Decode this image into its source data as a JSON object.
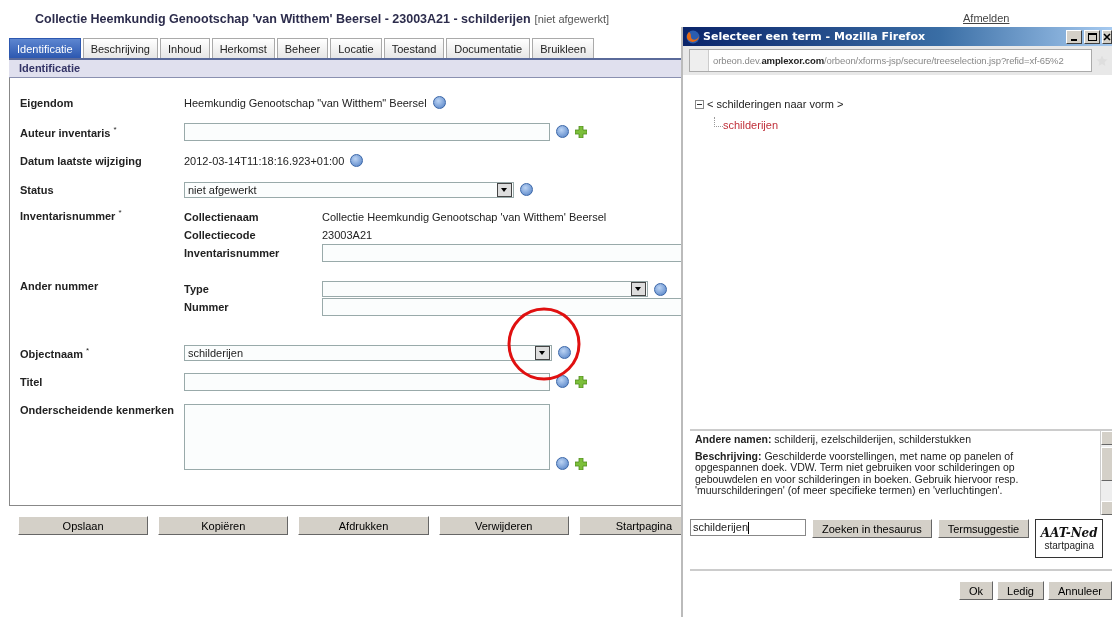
{
  "page": {
    "title": "Collectie Heemkundig Genootschap 'van Witthem' Beersel - 23003A21  - schilderijen",
    "status": "[niet afgewerkt]",
    "logout": "Afmelden"
  },
  "tabs": [
    {
      "label": "Identificatie",
      "selected": true
    },
    {
      "label": "Beschrijving",
      "selected": false
    },
    {
      "label": "Inhoud",
      "selected": false
    },
    {
      "label": "Herkomst",
      "selected": false
    },
    {
      "label": "Beheer",
      "selected": false
    },
    {
      "label": "Locatie",
      "selected": false
    },
    {
      "label": "Toestand",
      "selected": false
    },
    {
      "label": "Documentatie",
      "selected": false
    },
    {
      "label": "Bruikleen",
      "selected": false
    }
  ],
  "section": "Identificatie",
  "form": [
    {
      "label": "Eigendom",
      "kind": "text",
      "value": "Heemkundig Genootschap \"van Witthem\" Beersel",
      "help": true
    },
    {
      "label": "Auteur inventaris $^{*}$",
      "kind": "input",
      "help": true,
      "add": true
    },
    {
      "label": "Datum laatste wijziging",
      "kind": "text",
      "value": "2012-03-14T11:18:16.923+01:00",
      "help": true
    },
    {
      "label": "Status",
      "kind": "select",
      "value": "niet afgewerkt",
      "help": true
    },
    {
      "label": "Inventarisnummer $^{*}$",
      "kind": "group",
      "children": [
        {
          "label": "Collectienaam",
          "kind": "text",
          "value": "Collectie Heemkundig Genootschap 'van Witthem' Beersel"
        },
        {
          "label": "Collectiecode",
          "kind": "text",
          "value": "23003A21"
        },
        {
          "label": "Inventarisnummer",
          "kind": "input"
        }
      ]
    },
    {
      "label": "Ander nummer",
      "kind": "group",
      "children": [
        {
          "label": "Type",
          "kind": "select",
          "help": true
        },
        {
          "label": "Nummer",
          "kind": "input"
        }
      ]
    },
    {
      "label": "Objectnaam $^{*}$",
      "kind": "select",
      "value": "schilderijen",
      "help": true
    },
    {
      "label": "Titel",
      "kind": "input",
      "help": true,
      "add": true
    },
    {
      "label": "Onderscheidende kenmerken",
      "kind": "textarea",
      "help": true,
      "add": true
    }
  ],
  "buttons": [
    "Opslaan",
    "Kopiëren",
    "Afdrukken",
    "Verwijderen",
    "Startpagina"
  ],
  "popup": {
    "title": "Selecteer een term - Mozilla Firefox",
    "url": "orbeon.dev.**amplexor.com**/orbeon/xforms-jsp/secure/treeselection.jsp?refid=xf-65%2",
    "tree": [
      {
        "label": "< schilderingen naar vorm >",
        "expanded": true,
        "selected": false,
        "children": [
          {
            "label": "schilderijen",
            "selected": true
          }
        ]
      }
    ],
    "info": [
      "**Andere namen:** schilderij, ezelschilderijen, schilderstukken",
      "**Beschrijving:** Geschilderde voorstellingen, met name op panelen of opgespannen doek. VDW. Term niet gebruiken voor schilderingen op gebouwdelen en voor schilderingen in boeken. Gebruik hiervoor resp. 'muurschilderingen' (of meer specifieke termen) en 'verluchtingen'."
    ],
    "search_value": "schilderijen",
    "search_buttons": [
      "Zoeken in thesaurus",
      "Termsuggestie"
    ],
    "logo": {
      "mark": "AAT-Ned",
      "caption": "startpagina"
    },
    "buttons": [
      "Ok",
      "Ledig",
      "Annuleer"
    ]
  }
}
